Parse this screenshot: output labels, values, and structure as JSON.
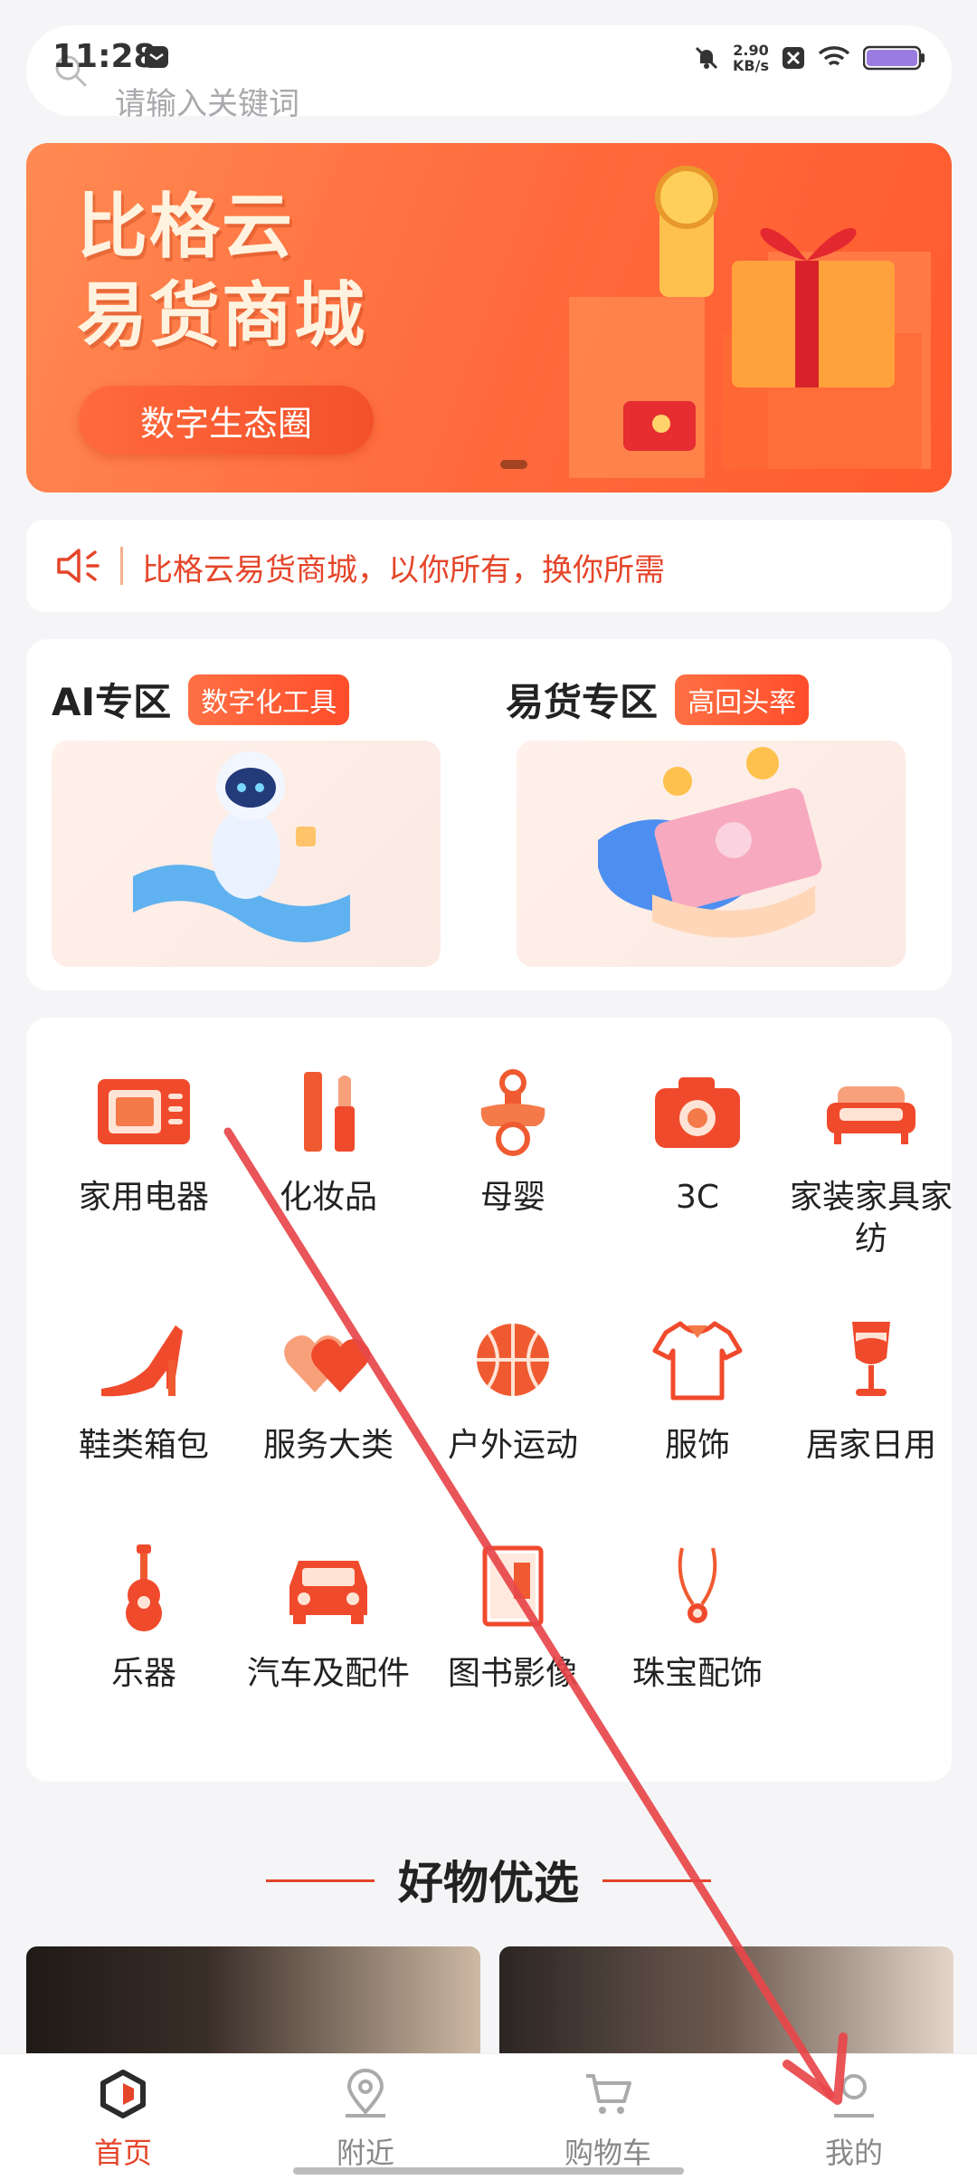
{
  "status_bar": {
    "time": "11:28",
    "speed_value": "2.90",
    "speed_unit": "KB/s"
  },
  "search": {
    "placeholder": "请输入关键词"
  },
  "banner": {
    "title_line1": "比格云",
    "title_line2": "易货商城",
    "pill": "数字生态圈"
  },
  "notice": {
    "text": "比格云易货商城，以你所有，换你所需"
  },
  "zones": [
    {
      "title": "AI专区",
      "tag": "数字化工具"
    },
    {
      "title": "易货专区",
      "tag": "高回头率"
    }
  ],
  "categories": [
    {
      "label": "家用电器",
      "icon": "appliance-icon"
    },
    {
      "label": "化妆品",
      "icon": "cosmetics-icon"
    },
    {
      "label": "母婴",
      "icon": "pacifier-icon"
    },
    {
      "label": "3C",
      "icon": "camera-icon"
    },
    {
      "label": "家装家具家纺",
      "icon": "sofa-icon"
    },
    {
      "label": "鞋类箱包",
      "icon": "high-heel-icon"
    },
    {
      "label": "服务大类",
      "icon": "hearts-icon"
    },
    {
      "label": "户外运动",
      "icon": "basketball-icon"
    },
    {
      "label": "服饰",
      "icon": "shirt-icon"
    },
    {
      "label": "居家日用",
      "icon": "glass-icon"
    },
    {
      "label": "乐器",
      "icon": "guitar-icon"
    },
    {
      "label": "汽车及配件",
      "icon": "car-icon"
    },
    {
      "label": "图书影像",
      "icon": "book-icon"
    },
    {
      "label": "珠宝配饰",
      "icon": "necklace-icon"
    }
  ],
  "section": {
    "title": "好物优选"
  },
  "bottom_nav": [
    {
      "label": "首页",
      "active": true
    },
    {
      "label": "附近",
      "active": false
    },
    {
      "label": "购物车",
      "active": false
    },
    {
      "label": "我的",
      "active": false
    }
  ],
  "colors": {
    "accent": "#e5452a",
    "banner": "#ff6d3e",
    "annotation_arrow": "#e8474a"
  }
}
